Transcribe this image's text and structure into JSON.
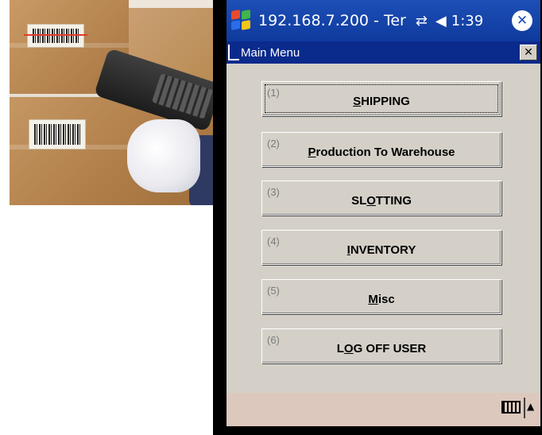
{
  "taskbar": {
    "title": "192.168.7.200 - Ter",
    "connectivity_icon": "connectivity-icon",
    "volume_icon": "volume-icon",
    "time": "1:39",
    "close_symbol": "✕"
  },
  "window": {
    "caption": "Main Menu",
    "close_symbol": "✕"
  },
  "menu": {
    "items": [
      {
        "num": "(1)",
        "label_pre": "",
        "mnemonic": "S",
        "label_post": "HIPPING"
      },
      {
        "num": "(2)",
        "label_pre": "",
        "mnemonic": "P",
        "label_post": "roduction To Warehouse"
      },
      {
        "num": "(3)",
        "label_pre": "SL",
        "mnemonic": "O",
        "label_post": "TTING"
      },
      {
        "num": "(4)",
        "label_pre": "",
        "mnemonic": "I",
        "label_post": "NVENTORY"
      },
      {
        "num": "(5)",
        "label_pre": "",
        "mnemonic": "M",
        "label_post": "isc"
      },
      {
        "num": "(6)",
        "label_pre": "L",
        "mnemonic": "O",
        "label_post": "G OFF USER"
      }
    ]
  },
  "bottombar": {
    "keyboard_icon": "keyboard-icon",
    "arrow": "▲"
  },
  "colors": {
    "taskbar_blue": "#1d4fb6",
    "titlebar_blue": "#0a2a8c",
    "dialog_gray": "#d4d0c8",
    "bottombar": "#dcc8bd"
  }
}
